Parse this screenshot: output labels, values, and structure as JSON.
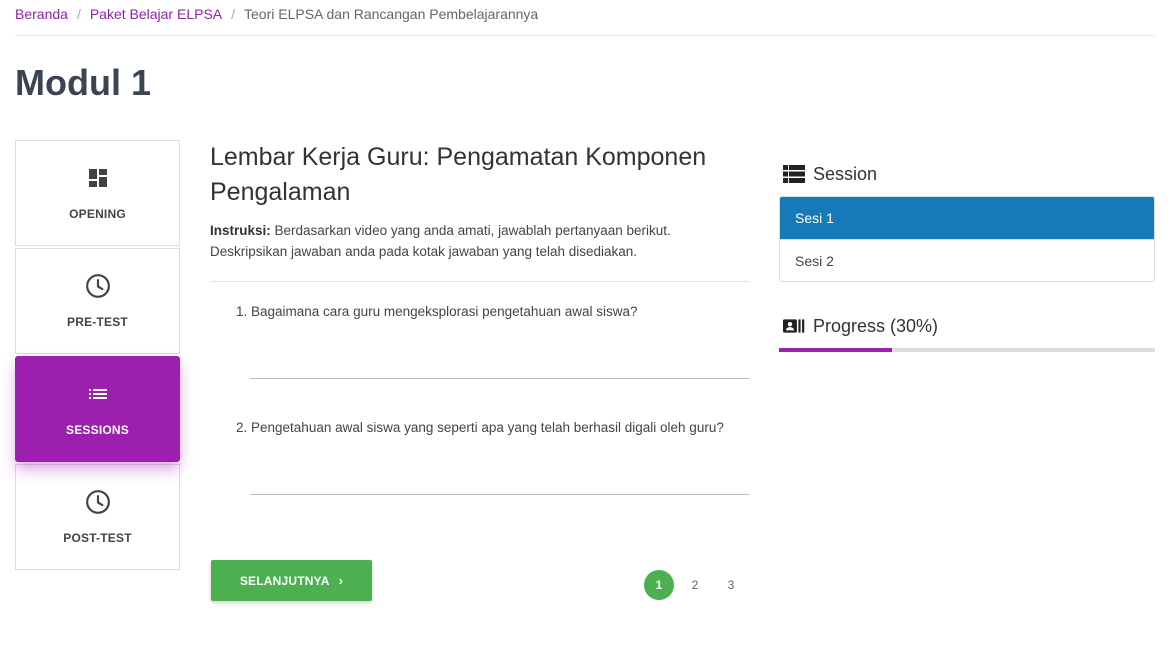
{
  "breadcrumb": {
    "items": [
      "Beranda",
      "Paket Belajar ELPSA"
    ],
    "current": "Teori ELPSA dan Rancangan Pembelajarannya"
  },
  "page_title": "Modul 1",
  "nav": {
    "items": [
      {
        "label": "OPENING",
        "icon": "dashboard-icon"
      },
      {
        "label": "PRE-TEST",
        "icon": "clock-icon"
      },
      {
        "label": "SESSIONS",
        "icon": "list-icon",
        "active": true
      },
      {
        "label": "POST-TEST",
        "icon": "clock-icon"
      }
    ]
  },
  "main": {
    "title": "Lembar Kerja Guru: Pengamatan Komponen Pengalaman",
    "instruction_label": "Instruksi:",
    "instruction_text": " Berdasarkan video yang anda amati, jawablah pertanyaan berikut. Deskripsikan jawaban anda pada kotak jawaban yang telah disediakan.",
    "questions": [
      "1. Bagaimana cara guru mengeksplorasi pengetahuan awal siswa?",
      "2. Pengetahuan awal siswa yang seperti apa yang telah berhasil digali oleh guru?"
    ],
    "next_label": "SELANJUTNYA",
    "pages": [
      "1",
      "2",
      "3"
    ],
    "active_page": "1"
  },
  "right": {
    "session_title": "Session",
    "sessions": [
      "Sesi 1",
      "Sesi 2"
    ],
    "active_session": "Sesi 1",
    "progress_title": "Progress (30%)",
    "progress_fraction": 0.3
  },
  "colors": {
    "accent": "#9c1fb0",
    "primary_blue": "#1679b8",
    "success": "#4caf50"
  }
}
